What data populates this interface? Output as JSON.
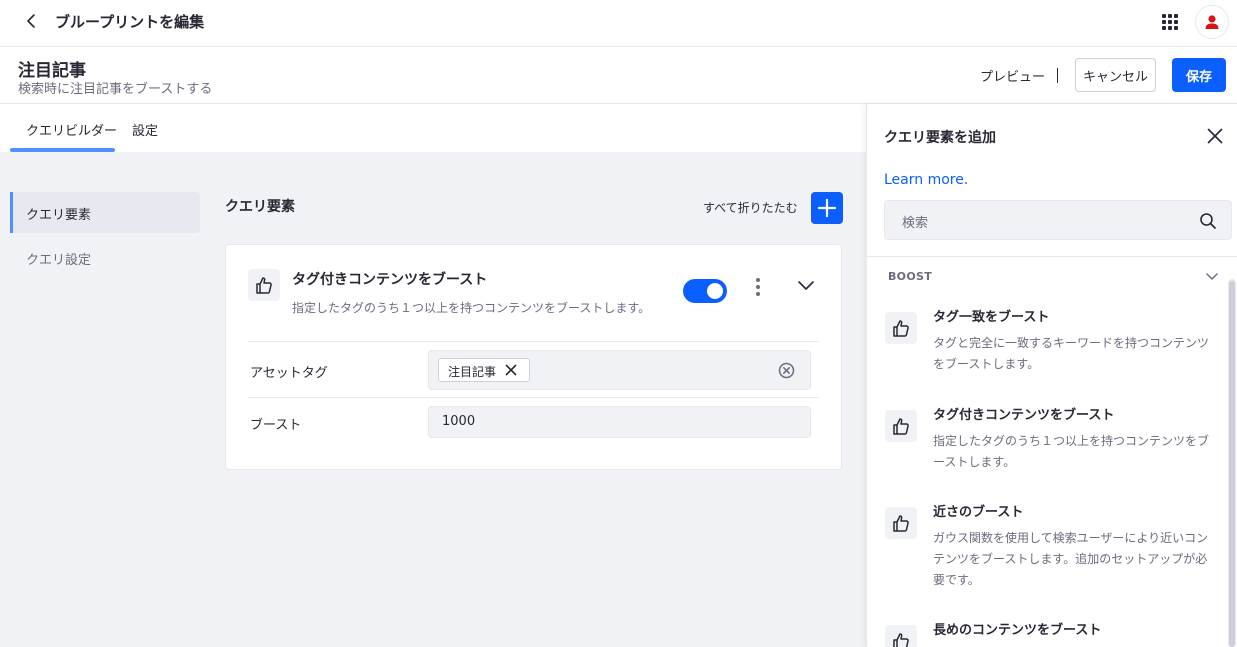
{
  "topbar": {
    "title": "ブループリントを編集"
  },
  "header": {
    "title": "注目記事",
    "subtitle": "検索時に注目記事をブーストする",
    "preview_label": "プレビュー",
    "cancel_label": "キャンセル",
    "save_label": "保存"
  },
  "tabs": [
    {
      "label": "クエリビルダー",
      "active": true
    },
    {
      "label": "設定",
      "active": false
    }
  ],
  "sidebar": {
    "items": [
      {
        "label": "クエリ要素",
        "active": true
      },
      {
        "label": "クエリ設定",
        "active": false
      }
    ]
  },
  "main": {
    "section_title": "クエリ要素",
    "collapse_all": "すべて折りたたむ",
    "card": {
      "title": "タグ付きコンテンツをブースト",
      "description": "指定したタグのうち１つ以上を持つコンテンツをブーストします。",
      "enabled": true,
      "fields": {
        "asset_tags_label": "アセットタグ",
        "asset_tags": [
          "注目記事"
        ],
        "boost_label": "ブースト",
        "boost_value": "1000"
      }
    }
  },
  "panel": {
    "title": "クエリ要素を追加",
    "learn_more": "Learn more.",
    "search_placeholder": "検索",
    "category": "BOOST",
    "items": [
      {
        "title": "タグ一致をブースト",
        "description": "タグと完全に一致するキーワードを持つコンテンツをブーストします。"
      },
      {
        "title": "タグ付きコンテンツをブースト",
        "description": "指定したタグのうち１つ以上を持つコンテンツをブーストします。"
      },
      {
        "title": "近さのブースト",
        "description": "ガウス関数を使用して検索ユーザーにより近いコンテンツをブーストします。追加のセットアップが必要です。"
      },
      {
        "title": "長めのコンテンツをブースト",
        "description": ""
      }
    ]
  },
  "colors": {
    "primary": "#0b5fff",
    "accent_underline": "#528fff",
    "avatar": "#da1414",
    "background_grey": "#f1f2f5"
  },
  "icons": {
    "back": "chevron-left-icon",
    "apps": "apps-grid-icon",
    "avatar": "user-icon",
    "add": "plus-icon",
    "element": "thumbs-up-icon",
    "menu": "kebab-icon",
    "expand": "chevron-down-icon",
    "close": "close-icon",
    "search": "search-icon",
    "clear": "times-circle-icon"
  }
}
